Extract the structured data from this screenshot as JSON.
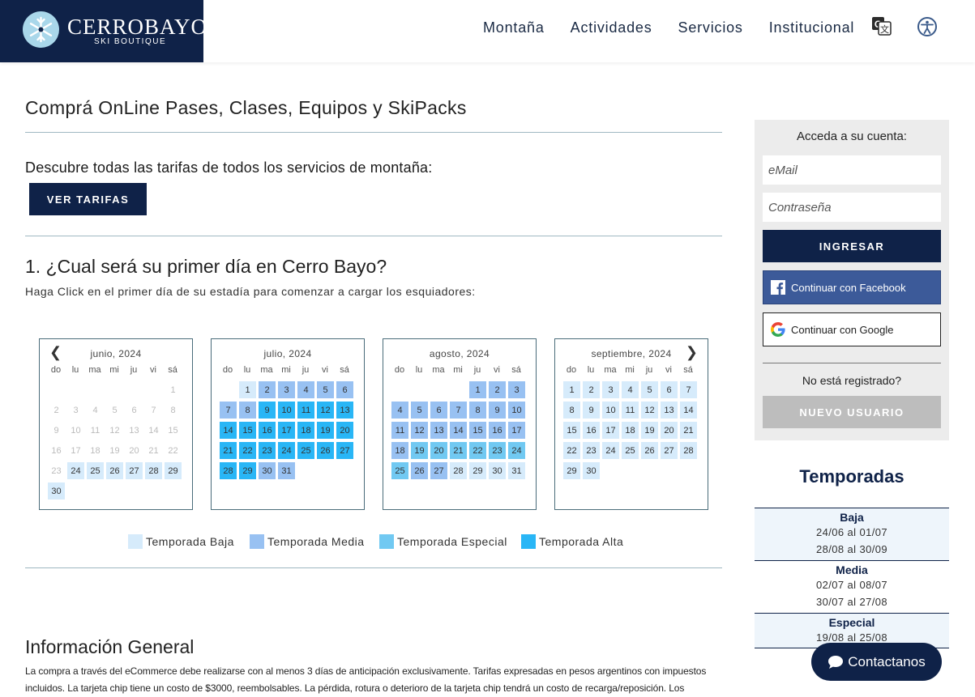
{
  "header": {
    "logo_title": "CERROBAYO",
    "logo_sub": "SKI BOUTIQUE",
    "nav": [
      "Montaña",
      "Actividades",
      "Servicios",
      "Institucional"
    ],
    "icons": [
      "translate-icon",
      "accessibility-icon"
    ]
  },
  "main": {
    "title": "Comprá OnLine Pases, Clases, Equipos y SkiPacks",
    "tarifas_text": "Descubre todas las tarifas de todos los servicios de montaña:",
    "tarifas_button": "VER TARIFAS",
    "step_title": "1. ¿Cual será su primer día en Cerro Bayo?",
    "step_sub": "Haga Click en el primer día de su estadía para comenzar a cargar los esquiadores:",
    "dow": [
      "do",
      "lu",
      "ma",
      "mi",
      "ju",
      "vi",
      "sá"
    ],
    "calendars": [
      {
        "title": "junio, 2024",
        "arrow": "‹",
        "cells": [
          [
            null,
            null,
            null,
            null,
            null,
            null,
            [
              "1",
              "d"
            ]
          ],
          [
            [
              "2",
              "d"
            ],
            [
              "3",
              "d"
            ],
            [
              "4",
              "d"
            ],
            [
              "5",
              "d"
            ],
            [
              "6",
              "d"
            ],
            [
              "7",
              "d"
            ],
            [
              "8",
              "d"
            ]
          ],
          [
            [
              "9",
              "d"
            ],
            [
              "10",
              "d"
            ],
            [
              "11",
              "d"
            ],
            [
              "12",
              "d"
            ],
            [
              "13",
              "d"
            ],
            [
              "14",
              "d"
            ],
            [
              "15",
              "d"
            ]
          ],
          [
            [
              "16",
              "d"
            ],
            [
              "17",
              "d"
            ],
            [
              "18",
              "d"
            ],
            [
              "19",
              "d"
            ],
            [
              "20",
              "d"
            ],
            [
              "21",
              "d"
            ],
            [
              "22",
              "d"
            ]
          ],
          [
            [
              "23",
              "d"
            ],
            [
              "24",
              "s1"
            ],
            [
              "25",
              "s1"
            ],
            [
              "26",
              "s1"
            ],
            [
              "27",
              "s1"
            ],
            [
              "28",
              "s1"
            ],
            [
              "29",
              "s1"
            ]
          ],
          [
            [
              "30",
              "s1"
            ]
          ]
        ]
      },
      {
        "title": "julio, 2024",
        "cells": [
          [
            null,
            [
              "1",
              "s1"
            ],
            [
              "2",
              "s2"
            ],
            [
              "3",
              "s2"
            ],
            [
              "4",
              "s2"
            ],
            [
              "5",
              "s2"
            ],
            [
              "6",
              "s2"
            ]
          ],
          [
            [
              "7",
              "s2"
            ],
            [
              "8",
              "s2"
            ],
            [
              "9",
              "s4"
            ],
            [
              "10",
              "s4"
            ],
            [
              "11",
              "s4"
            ],
            [
              "12",
              "s4"
            ],
            [
              "13",
              "s4"
            ]
          ],
          [
            [
              "14",
              "s4"
            ],
            [
              "15",
              "s4"
            ],
            [
              "16",
              "s4"
            ],
            [
              "17",
              "s4"
            ],
            [
              "18",
              "s4"
            ],
            [
              "19",
              "s4"
            ],
            [
              "20",
              "s4"
            ]
          ],
          [
            [
              "21",
              "s4"
            ],
            [
              "22",
              "s4"
            ],
            [
              "23",
              "s4"
            ],
            [
              "24",
              "s4"
            ],
            [
              "25",
              "s4"
            ],
            [
              "26",
              "s4"
            ],
            [
              "27",
              "s4"
            ]
          ],
          [
            [
              "28",
              "s4"
            ],
            [
              "29",
              "s4"
            ],
            [
              "30",
              "s2"
            ],
            [
              "31",
              "s2"
            ]
          ]
        ]
      },
      {
        "title": "agosto, 2024",
        "cells": [
          [
            null,
            null,
            null,
            null,
            [
              "1",
              "s2"
            ],
            [
              "2",
              "s2"
            ],
            [
              "3",
              "s2"
            ]
          ],
          [
            [
              "4",
              "s2"
            ],
            [
              "5",
              "s2"
            ],
            [
              "6",
              "s2"
            ],
            [
              "7",
              "s2"
            ],
            [
              "8",
              "s2"
            ],
            [
              "9",
              "s2"
            ],
            [
              "10",
              "s2"
            ]
          ],
          [
            [
              "11",
              "s2"
            ],
            [
              "12",
              "s2"
            ],
            [
              "13",
              "s2"
            ],
            [
              "14",
              "s2"
            ],
            [
              "15",
              "s2"
            ],
            [
              "16",
              "s2"
            ],
            [
              "17",
              "s2"
            ]
          ],
          [
            [
              "18",
              "s2"
            ],
            [
              "19",
              "s3"
            ],
            [
              "20",
              "s3"
            ],
            [
              "21",
              "s3"
            ],
            [
              "22",
              "s3"
            ],
            [
              "23",
              "s3"
            ],
            [
              "24",
              "s3"
            ]
          ],
          [
            [
              "25",
              "s3"
            ],
            [
              "26",
              "s2"
            ],
            [
              "27",
              "s2"
            ],
            [
              "28",
              "s1"
            ],
            [
              "29",
              "s1"
            ],
            [
              "30",
              "s1"
            ],
            [
              "31",
              "s1"
            ]
          ]
        ]
      },
      {
        "title": "septiembre, 2024",
        "arrow": "›",
        "cells": [
          [
            [
              "1",
              "s1"
            ],
            [
              "2",
              "s1"
            ],
            [
              "3",
              "s1"
            ],
            [
              "4",
              "s1"
            ],
            [
              "5",
              "s1"
            ],
            [
              "6",
              "s1"
            ],
            [
              "7",
              "s1"
            ]
          ],
          [
            [
              "8",
              "s1"
            ],
            [
              "9",
              "s1"
            ],
            [
              "10",
              "s1"
            ],
            [
              "11",
              "s1"
            ],
            [
              "12",
              "s1"
            ],
            [
              "13",
              "s1"
            ],
            [
              "14",
              "s1"
            ]
          ],
          [
            [
              "15",
              "s1"
            ],
            [
              "16",
              "s1"
            ],
            [
              "17",
              "s1"
            ],
            [
              "18",
              "s1"
            ],
            [
              "19",
              "s1"
            ],
            [
              "20",
              "s1"
            ],
            [
              "21",
              "s1"
            ]
          ],
          [
            [
              "22",
              "s1"
            ],
            [
              "23",
              "s1"
            ],
            [
              "24",
              "s1"
            ],
            [
              "25",
              "s1"
            ],
            [
              "26",
              "s1"
            ],
            [
              "27",
              "s1"
            ],
            [
              "28",
              "s1"
            ]
          ],
          [
            [
              "29",
              "s1"
            ],
            [
              "30",
              "s1"
            ]
          ]
        ]
      }
    ],
    "legend": [
      {
        "label": "Temporada Baja",
        "color": "#d6ebfb"
      },
      {
        "label": "Temporada Media",
        "color": "#98c1f2"
      },
      {
        "label": "Temporada Especial",
        "color": "#71c9f2"
      },
      {
        "label": "Temporada Alta",
        "color": "#29b6f6"
      }
    ],
    "info_title": "Información General",
    "info_text": "La compra a través del eCommerce debe realizarse con al menos 3 días de anticipación exclusivamente. Tarifas expresadas en pesos argentinos con impuestos incluidos. La tarjeta chip tiene un costo de $3000, reembolsables. La pérdida, rotura o deterioro de la tarjeta chip tendrá un costo de recarga/reposición. Los"
  },
  "login": {
    "title": "Acceda a su cuenta:",
    "email_placeholder": "eMail",
    "password_placeholder": "Contraseña",
    "login_button": "INGRESAR",
    "facebook_button": "Continuar con Facebook",
    "google_button": "Continuar con Google",
    "not_registered": "No está registrado?",
    "new_user_button": "NUEVO USUARIO"
  },
  "temporadas": {
    "title": "Temporadas",
    "items": [
      {
        "name": "Baja",
        "ranges": [
          "24/06 al 01/07",
          "28/08 al 30/09"
        ]
      },
      {
        "name": "Media",
        "ranges": [
          "02/07 al 08/07",
          "30/07 al 27/08"
        ]
      },
      {
        "name": "Especial",
        "ranges": [
          "19/08 al 25/08"
        ]
      }
    ]
  },
  "contact_button": "Contactanos",
  "colors": {
    "brand": "#0f2248",
    "baja": "#d6ebfb",
    "media": "#98c1f2",
    "especial": "#71c9f2",
    "alta": "#29b6f6"
  }
}
